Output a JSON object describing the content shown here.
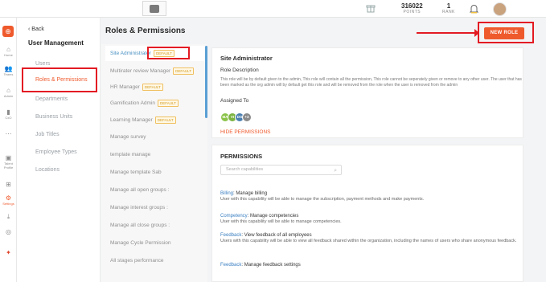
{
  "topbar": {
    "points_value": "316022",
    "points_label": "POINTS",
    "rank_value": "1",
    "rank_label": "RANK"
  },
  "rail": {
    "items": [
      {
        "icon": "home-icon",
        "label": "Home"
      },
      {
        "icon": "teams-icon",
        "label": "Teams"
      },
      {
        "icon": "admin-icon",
        "label": "Admin"
      },
      {
        "icon": "chart-icon",
        "label": "CxO"
      },
      {
        "icon": "more-icon",
        "label": ""
      },
      {
        "icon": "talent-icon",
        "label": "Talent Profile"
      },
      {
        "icon": "grid-icon",
        "label": ""
      },
      {
        "icon": "settings-icon",
        "label": "Settings"
      },
      {
        "icon": "download-icon",
        "label": ""
      },
      {
        "icon": "globe-icon",
        "label": ""
      }
    ]
  },
  "sidebar": {
    "back_label": "Back",
    "section_title": "User Management",
    "items": [
      {
        "label": "Users"
      },
      {
        "label": "Roles & Permissions"
      },
      {
        "label": "Departments"
      },
      {
        "label": "Business Units"
      },
      {
        "label": "Job Titles"
      },
      {
        "label": "Employee Types"
      },
      {
        "label": "Locations"
      }
    ]
  },
  "main": {
    "title": "Roles & Permissions",
    "new_role_label": "NEW ROLE"
  },
  "roles": [
    {
      "label": "Site Administrator",
      "tag": "DEFAULT"
    },
    {
      "label": "Multirater review Manager",
      "tag": "DEFAULT"
    },
    {
      "label": "HR Manager",
      "tag": "DEFAULT"
    },
    {
      "label": "Gamification Admin",
      "tag": "DEFAULT"
    },
    {
      "label": "Learning Manager",
      "tag": "DEFAULT"
    },
    {
      "label": "Manage survey",
      "tag": ""
    },
    {
      "label": "template manage",
      "tag": ""
    },
    {
      "label": "Manage template Sab",
      "tag": ""
    },
    {
      "label": "Manage all open groups :",
      "tag": ""
    },
    {
      "label": "Manage interest groups :",
      "tag": ""
    },
    {
      "label": "Manage all close groups :",
      "tag": ""
    },
    {
      "label": "Manage Cycle Permission",
      "tag": ""
    },
    {
      "label": "All stages performance",
      "tag": ""
    }
  ],
  "detail": {
    "title": "Site Administrator",
    "role_desc_label": "Role Description",
    "role_desc": "This role will be by default given to the admin, This role will contain all the permission, This role cannot be seperately given or remove to any other user. The user that has been marked as the org admin will by default get this role and will be removed from the role when the user is removed from the admin",
    "assigned_label": "Assigned To",
    "assignees": [
      {
        "initials": "MA",
        "color": "#8bc34a"
      },
      {
        "initials": "VI",
        "color": "#7cb342"
      },
      {
        "initials": "DO",
        "color": "#4a7fb0"
      },
      {
        "initials": "+3",
        "color": "#8a8a8a"
      }
    ],
    "hide_label": "HIDE PERMISSIONS"
  },
  "permissions": {
    "title": "PERMISSIONS",
    "search_placeholder": "Search capabilities",
    "items": [
      {
        "category": "Billing",
        "name": ": Manage billing",
        "desc": "User with this capability will be able to manage the subscription, payment methods and make payments."
      },
      {
        "category": "Competency",
        "name": ": Manage competencies",
        "desc": "User with this capability will be able to manage competencies."
      },
      {
        "category": "Feedback",
        "name": ": View feedback of all employees",
        "desc": "Users with this capability will be able to view all feedback shared within the organization, including the names of users who share anonymous feedback."
      },
      {
        "category": "Feedback",
        "name": ": Manage feedback settings",
        "desc": ""
      }
    ]
  },
  "colors": {
    "accent": "#ef5a2d",
    "highlight": "#e31b23",
    "link": "#3a7fc1"
  }
}
